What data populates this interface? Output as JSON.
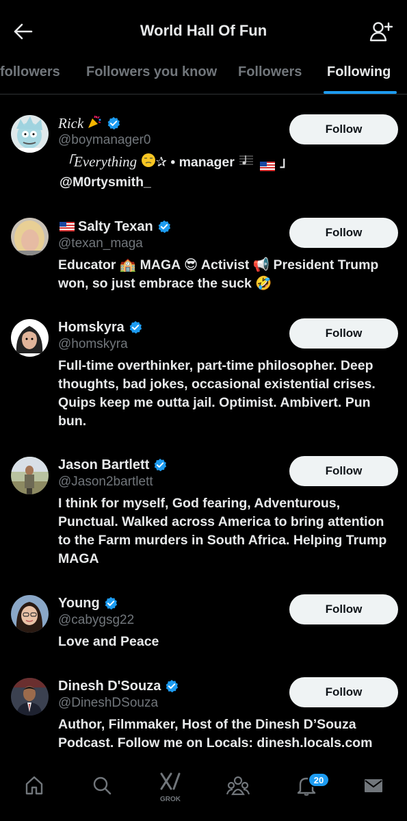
{
  "header": {
    "title": "World Hall Of Fun"
  },
  "tabs": [
    {
      "label": "followers",
      "active": false
    },
    {
      "label": "Followers you know",
      "active": false
    },
    {
      "label": "Followers",
      "active": false
    },
    {
      "label": "Following",
      "active": true
    }
  ],
  "users": [
    {
      "name": "Rick",
      "handle": "@boymanager0",
      "bio_line1": "「Everything",
      "bio_line1b": "• manager",
      "bio_line1c": "」",
      "bio_line2": "@M0rtysmith_",
      "follow_label": "Follow"
    },
    {
      "name": "Salty Texan",
      "handle": "@texan_maga",
      "bio": "Educator 🏫 MAGA 😎 Activist 📢 President Trump won, so just embrace the suck 🤣",
      "follow_label": "Follow"
    },
    {
      "name": "Homskyra",
      "handle": "@homskyra",
      "bio": "Full-time overthinker, part-time philosopher. Deep thoughts, bad jokes, occasional existential crises. Quips keep me outta jail. Optimist. Ambivert. Pun bun.",
      "follow_label": "Follow"
    },
    {
      "name": "Jason Bartlett",
      "handle": "@Jason2bartlett",
      "bio": "I think for myself, God fearing, Adventurous, Punctual. Walked across America to bring attention to the Farm murders in South Africa. Helping Trump MAGA",
      "follow_label": "Follow"
    },
    {
      "name": "Young",
      "handle": "@cabygsg22",
      "bio": "Love and Peace",
      "follow_label": "Follow"
    },
    {
      "name": "Dinesh D'Souza",
      "handle": "@DineshDSouza",
      "bio": "Author, Filmmaker, Host of the Dinesh D’Souza Podcast. Follow me on Locals: dinesh.locals.com",
      "follow_label": "Follow"
    }
  ],
  "bottom_nav": {
    "items": [
      "home-icon",
      "search-icon",
      "grok-icon",
      "communities-icon",
      "notifications-icon",
      "messages-icon"
    ],
    "grok_label": "GROK",
    "notification_count": "20"
  },
  "colors": {
    "accent": "#1d9bf0",
    "background": "#000000",
    "muted": "#71767b",
    "button": "#eff3f4"
  }
}
